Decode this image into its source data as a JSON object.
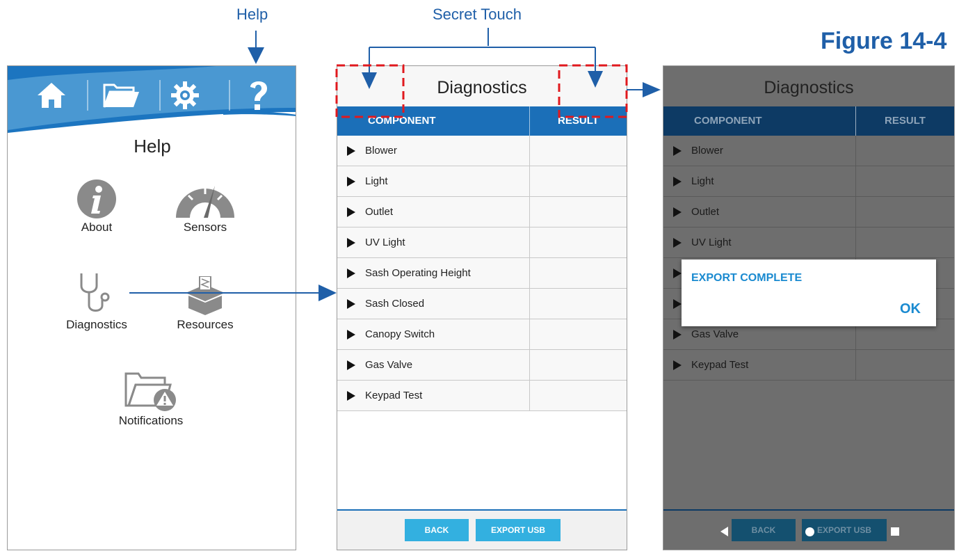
{
  "figure_label": "Figure 14-4",
  "callouts": {
    "help": "Help",
    "secret_touch": "Secret Touch"
  },
  "left_screen": {
    "header_icons": [
      "home-icon",
      "folder-icon",
      "gear-icon",
      "question-icon"
    ],
    "title": "Help",
    "items": [
      {
        "label": "About",
        "icon": "info-icon"
      },
      {
        "label": "Sensors",
        "icon": "gauge-icon"
      },
      {
        "label": "Diagnostics",
        "icon": "stethoscope-icon"
      },
      {
        "label": "Resources",
        "icon": "box-icon"
      },
      {
        "label": "Notifications",
        "icon": "folder-warning-icon"
      }
    ],
    "colors": {
      "header": "#1c75c0",
      "header_light": "#4a98d2"
    }
  },
  "diagnostics": {
    "title": "Diagnostics",
    "col_component": "COMPONENT",
    "col_result": "RESULT",
    "rows": [
      "Blower",
      "Light",
      "Outlet",
      "UV Light",
      "Sash Operating Height",
      "Sash Closed",
      "Canopy Switch",
      "Gas Valve",
      "Keypad Test"
    ],
    "back_label": "BACK",
    "export_label": "EXPORT USB",
    "colors": {
      "header": "#1b6fb8",
      "button": "#33b0e0"
    }
  },
  "export_screen": {
    "title": "Diagnostics",
    "col_component": "COMPONENT",
    "col_result": "RESULT",
    "rows": [
      "Blower",
      "Light",
      "Outlet",
      "UV Light",
      "",
      "",
      "Gas Valve",
      "Keypad Test"
    ],
    "dialog_title": "EXPORT COMPLETE",
    "dialog_ok": "OK",
    "back_label": "BACK",
    "export_label": "EXPORT USB",
    "colors": {
      "dialog_text": "#1a8ad0",
      "dim_bg": "#6e6e6e"
    }
  }
}
